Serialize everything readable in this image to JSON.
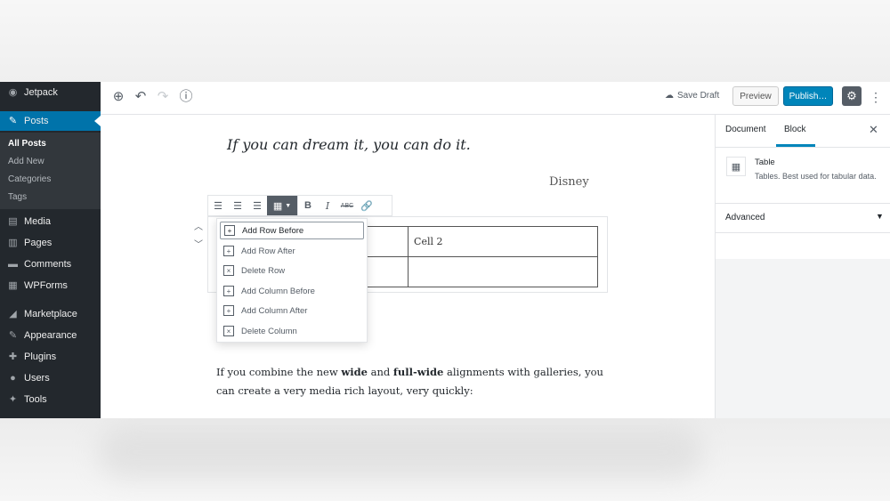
{
  "sidebar": {
    "items": [
      {
        "label": "Jetpack",
        "icon": "jetpack-icon",
        "glyph": "◉"
      },
      {
        "label": "Posts",
        "icon": "pushpin-icon",
        "glyph": "✎"
      },
      {
        "label": "Media",
        "icon": "media-icon",
        "glyph": "▤"
      },
      {
        "label": "Pages",
        "icon": "pages-icon",
        "glyph": "▥"
      },
      {
        "label": "Comments",
        "icon": "comments-icon",
        "glyph": "▬"
      },
      {
        "label": "WPForms",
        "icon": "wpforms-icon",
        "glyph": "▦"
      },
      {
        "label": "Marketplace",
        "icon": "marketplace-icon",
        "glyph": "◢"
      },
      {
        "label": "Appearance",
        "icon": "paintbrush-icon",
        "glyph": "✎"
      },
      {
        "label": "Plugins",
        "icon": "plugin-icon",
        "glyph": "✚"
      },
      {
        "label": "Users",
        "icon": "users-icon",
        "glyph": "●"
      },
      {
        "label": "Tools",
        "icon": "wrench-icon",
        "glyph": "✦"
      }
    ],
    "submenu": [
      "All Posts",
      "Add New",
      "Categories",
      "Tags"
    ]
  },
  "topbar": {
    "save_draft": "Save Draft",
    "preview": "Preview",
    "publish": "Publish…"
  },
  "editor": {
    "quote": "If you can dream it, you can do it.",
    "citation": "Disney",
    "table": {
      "rows": [
        [
          "",
          "Cell 2"
        ],
        [
          "",
          ""
        ]
      ]
    },
    "table_menu": [
      "Add Row Before",
      "Add Row After",
      "Delete Row",
      "Add Column Before",
      "Add Column After",
      "Delete Column"
    ],
    "paragraph": {
      "p1": "If you combine the new ",
      "b1": "wide",
      "p2": " and ",
      "b2": "full-wide",
      "p3": " alignments with galleries, you can create a very media rich layout, very quickly:"
    }
  },
  "panel": {
    "tab_document": "Document",
    "tab_block": "Block",
    "block_title": "Table",
    "block_desc": "Tables. Best used for tabular data.",
    "advanced": "Advanced"
  },
  "colors": {
    "accent": "#0085ba",
    "sidebar_bg": "#23282d",
    "active": "#0073aa"
  }
}
